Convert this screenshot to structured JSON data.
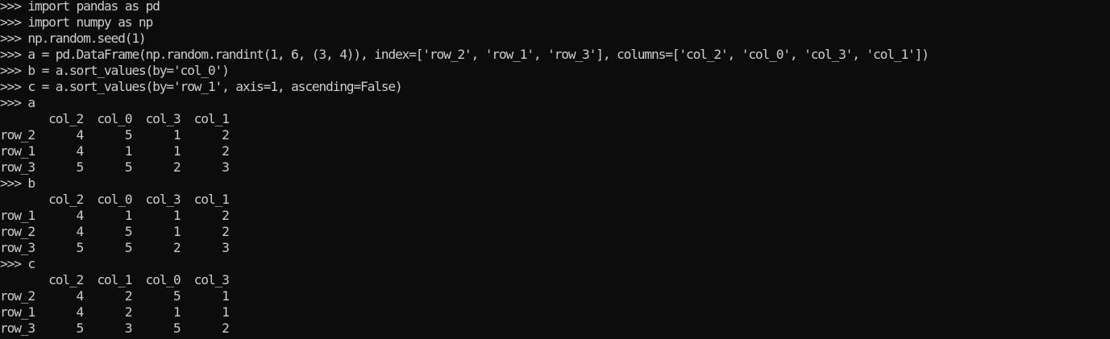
{
  "terminal": {
    "lines": [
      ">>> import pandas as pd",
      ">>> import numpy as np",
      ">>> np.random.seed(1)",
      ">>> a = pd.DataFrame(np.random.randint(1, 6, (3, 4)), index=['row_2', 'row_1', 'row_3'], columns=['col_2', 'col_0', 'col_3', 'col_1'])",
      ">>> b = a.sort_values(by='col_0')",
      ">>> c = a.sort_values(by='row_1', axis=1, ascending=False)",
      ">>> a",
      "       col_2  col_0  col_3  col_1",
      "row_2      4      5      1      2",
      "row_1      4      1      1      2",
      "row_3      5      5      2      3",
      ">>> b",
      "       col_2  col_0  col_3  col_1",
      "row_1      4      1      1      2",
      "row_2      4      5      1      2",
      "row_3      5      5      2      3",
      ">>> c",
      "       col_2  col_1  col_0  col_3",
      "row_2      4      2      5      1",
      "row_1      4      2      1      1",
      "row_3      5      3      5      2"
    ]
  },
  "colors": {
    "background": "#0c0c0c",
    "text": "#cccccc"
  }
}
